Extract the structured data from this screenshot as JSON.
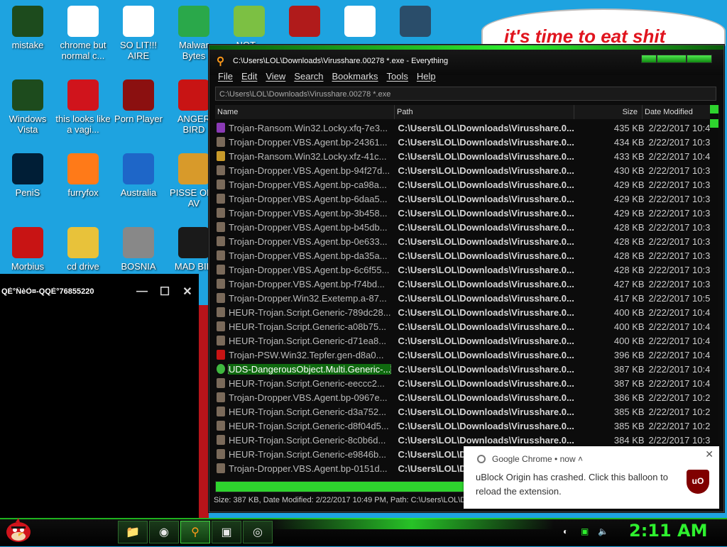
{
  "desktop_icons": [
    {
      "label": "mistake",
      "icon": "xbox-icon",
      "color": "#1d4b1d"
    },
    {
      "label": "chrome but normal c...",
      "icon": "chrome-icon",
      "color": "#ffffff"
    },
    {
      "label": "SO LIT!!! AIRE",
      "icon": "solitaire-icon",
      "color": "#ffffff"
    },
    {
      "label": "Malwar Bytes",
      "icon": "shield-icon",
      "color": "#2aa84a"
    },
    {
      "label": "NOT...",
      "icon": "bad-piggies-icon",
      "color": "#7cc043"
    },
    {
      "label": "",
      "icon": "exploit-icon",
      "color": "#b01b1b"
    },
    {
      "label": "",
      "icon": "media-player-classic-icon",
      "color": "#ffffff"
    },
    {
      "label": "",
      "icon": "grid-app-icon",
      "color": "#2a4d6a"
    },
    {
      "label": "Windows Vista",
      "icon": "recycle-icon",
      "color": "#1d4b1d"
    },
    {
      "label": "this looks like a vagi...",
      "icon": "opera-icon",
      "color": "#d0141c"
    },
    {
      "label": "Porn Player",
      "icon": "flash-icon",
      "color": "#8b1010"
    },
    {
      "label": "ANGER BIRD",
      "icon": "angry-birds-icon",
      "color": "#c81414"
    },
    {
      "label": "PeniS",
      "icon": "photoshop-icon",
      "color": "#001e36"
    },
    {
      "label": "furryfox",
      "icon": "firefox-icon",
      "color": "#ff7a18"
    },
    {
      "label": "Australia",
      "icon": "spider-solitaire-icon",
      "color": "#1e66c8"
    },
    {
      "label": "PISSE OFF AV",
      "icon": "angry-birds-seasons-icon",
      "color": "#d89a2a"
    },
    {
      "label": "Morbius",
      "icon": "acrobat-icon",
      "color": "#c81414"
    },
    {
      "label": "cd drive",
      "icon": "cd-icon",
      "color": "#e8c23a"
    },
    {
      "label": "BOSNIA",
      "icon": "minesweeper-icon",
      "color": "#888888"
    },
    {
      "label": "MAD BIR",
      "icon": "angry-birds-space-icon",
      "color": "#1a1a1a"
    }
  ],
  "bubble_text": "it's time to eat shit",
  "dark_window": {
    "title": "QÈ°ÑèÒ¤-QQÈ°76855220",
    "minimize": "—",
    "maximize": "☐",
    "close": "✕"
  },
  "everything": {
    "title": "C:\\Users\\LOL\\Downloads\\Virusshare.00278 *.exe - Everything",
    "menu": [
      "File",
      "Edit",
      "View",
      "Search",
      "Bookmarks",
      "Tools",
      "Help"
    ],
    "search_value": "C:\\Users\\LOL\\Downloads\\Virusshare.00278 *.exe",
    "columns": [
      "Name",
      "Path",
      "Size",
      "Date Modified"
    ],
    "rows": [
      {
        "name": "Trojan-Ransom.Win32.Locky.xfq-7e3...",
        "path": "C:\\Users\\LOL\\Downloads\\Virusshare.0...",
        "size": "435 KB",
        "date": "2/22/2017 10:4",
        "icon_color": "#8a3ab5"
      },
      {
        "name": "Trojan-Dropper.VBS.Agent.bp-24361...",
        "path": "C:\\Users\\LOL\\Downloads\\Virusshare.0...",
        "size": "434 KB",
        "date": "2/22/2017 10:3",
        "icon_color": "#7a6a5a"
      },
      {
        "name": "Trojan-Ransom.Win32.Locky.xfz-41c...",
        "path": "C:\\Users\\LOL\\Downloads\\Virusshare.0...",
        "size": "433 KB",
        "date": "2/22/2017 10:4",
        "icon_color": "#c89a2a"
      },
      {
        "name": "Trojan-Dropper.VBS.Agent.bp-94f27d...",
        "path": "C:\\Users\\LOL\\Downloads\\Virusshare.0...",
        "size": "430 KB",
        "date": "2/22/2017 10:3",
        "icon_color": "#7a6a5a"
      },
      {
        "name": "Trojan-Dropper.VBS.Agent.bp-ca98a...",
        "path": "C:\\Users\\LOL\\Downloads\\Virusshare.0...",
        "size": "429 KB",
        "date": "2/22/2017 10:3",
        "icon_color": "#7a6a5a"
      },
      {
        "name": "Trojan-Dropper.VBS.Agent.bp-6daa5...",
        "path": "C:\\Users\\LOL\\Downloads\\Virusshare.0...",
        "size": "429 KB",
        "date": "2/22/2017 10:3",
        "icon_color": "#7a6a5a"
      },
      {
        "name": "Trojan-Dropper.VBS.Agent.bp-3b458...",
        "path": "C:\\Users\\LOL\\Downloads\\Virusshare.0...",
        "size": "429 KB",
        "date": "2/22/2017 10:3",
        "icon_color": "#7a6a5a"
      },
      {
        "name": "Trojan-Dropper.VBS.Agent.bp-b45db...",
        "path": "C:\\Users\\LOL\\Downloads\\Virusshare.0...",
        "size": "428 KB",
        "date": "2/22/2017 10:3",
        "icon_color": "#7a6a5a"
      },
      {
        "name": "Trojan-Dropper.VBS.Agent.bp-0e633...",
        "path": "C:\\Users\\LOL\\Downloads\\Virusshare.0...",
        "size": "428 KB",
        "date": "2/22/2017 10:3",
        "icon_color": "#7a6a5a"
      },
      {
        "name": "Trojan-Dropper.VBS.Agent.bp-da35a...",
        "path": "C:\\Users\\LOL\\Downloads\\Virusshare.0...",
        "size": "428 KB",
        "date": "2/22/2017 10:3",
        "icon_color": "#7a6a5a"
      },
      {
        "name": "Trojan-Dropper.VBS.Agent.bp-6c6f55...",
        "path": "C:\\Users\\LOL\\Downloads\\Virusshare.0...",
        "size": "428 KB",
        "date": "2/22/2017 10:3",
        "icon_color": "#7a6a5a"
      },
      {
        "name": "Trojan-Dropper.VBS.Agent.bp-f74bd...",
        "path": "C:\\Users\\LOL\\Downloads\\Virusshare.0...",
        "size": "427 KB",
        "date": "2/22/2017 10:3",
        "icon_color": "#7a6a5a"
      },
      {
        "name": "Trojan-Dropper.Win32.Exetemp.a-87...",
        "path": "C:\\Users\\LOL\\Downloads\\Virusshare.0...",
        "size": "417 KB",
        "date": "2/22/2017 10:5",
        "icon_color": "#7a6a5a"
      },
      {
        "name": "HEUR-Trojan.Script.Generic-789dc28...",
        "path": "C:\\Users\\LOL\\Downloads\\Virusshare.0...",
        "size": "400 KB",
        "date": "2/22/2017 10:4",
        "icon_color": "#7a6a5a"
      },
      {
        "name": "HEUR-Trojan.Script.Generic-a08b75...",
        "path": "C:\\Users\\LOL\\Downloads\\Virusshare.0...",
        "size": "400 KB",
        "date": "2/22/2017 10:4",
        "icon_color": "#7a6a5a"
      },
      {
        "name": "HEUR-Trojan.Script.Generic-d71ea8...",
        "path": "C:\\Users\\LOL\\Downloads\\Virusshare.0...",
        "size": "400 KB",
        "date": "2/22/2017 10:4",
        "icon_color": "#7a6a5a"
      },
      {
        "name": "Trojan-PSW.Win32.Tepfer.gen-d8a0...",
        "path": "C:\\Users\\LOL\\Downloads\\Virusshare.0...",
        "size": "396 KB",
        "date": "2/22/2017 10:4",
        "icon_color": "#c81414"
      },
      {
        "name": "UDS-DangerousObject.Multi.Generic-...",
        "path": "C:\\Users\\LOL\\Downloads\\Virusshare.0...",
        "size": "387 KB",
        "date": "2/22/2017 10:4",
        "icon_color": "#3fb83f",
        "selected": true
      },
      {
        "name": "HEUR-Trojan.Script.Generic-eeccc2...",
        "path": "C:\\Users\\LOL\\Downloads\\Virusshare.0...",
        "size": "387 KB",
        "date": "2/22/2017 10:4",
        "icon_color": "#7a6a5a"
      },
      {
        "name": "Trojan-Dropper.VBS.Agent.bp-0967e...",
        "path": "C:\\Users\\LOL\\Downloads\\Virusshare.0...",
        "size": "386 KB",
        "date": "2/22/2017 10:2",
        "icon_color": "#7a6a5a"
      },
      {
        "name": "HEUR-Trojan.Script.Generic-d3a752...",
        "path": "C:\\Users\\LOL\\Downloads\\Virusshare.0...",
        "size": "385 KB",
        "date": "2/22/2017 10:2",
        "icon_color": "#7a6a5a"
      },
      {
        "name": "HEUR-Trojan.Script.Generic-d8f04d5...",
        "path": "C:\\Users\\LOL\\Downloads\\Virusshare.0...",
        "size": "385 KB",
        "date": "2/22/2017 10:2",
        "icon_color": "#7a6a5a"
      },
      {
        "name": "HEUR-Trojan.Script.Generic-8c0b6d...",
        "path": "C:\\Users\\LOL\\Downloads\\Virusshare.0...",
        "size": "384 KB",
        "date": "2/22/2017 10:3",
        "icon_color": "#7a6a5a"
      },
      {
        "name": "HEUR-Trojan.Script.Generic-e9846b...",
        "path": "C:\\Users\\LOL\\D",
        "size": "",
        "date": "",
        "icon_color": "#7a6a5a"
      },
      {
        "name": "Trojan-Dropper.VBS.Agent.bp-0151d...",
        "path": "C:\\Users\\LOL\\D",
        "size": "",
        "date": "",
        "icon_color": "#7a6a5a"
      }
    ],
    "status": "Size: 387 KB, Date Modified: 2/22/2017 10:49 PM, Path: C:\\Users\\LOL\\Do"
  },
  "notification": {
    "app": "Google Chrome",
    "time": "now",
    "message": "uBlock Origin has crashed. Click this balloon to reload the extension.",
    "badge": "uO",
    "close": "✕"
  },
  "taskbar": {
    "items": [
      {
        "name": "taskbar-file-explorer",
        "icon": "folder-icon",
        "glyph": "📁"
      },
      {
        "name": "taskbar-chrome",
        "icon": "chrome-icon",
        "glyph": "◉"
      },
      {
        "name": "taskbar-everything",
        "icon": "search-icon",
        "glyph": "⚲",
        "active": true
      },
      {
        "name": "taskbar-app4",
        "icon": "window-icon",
        "glyph": "▣"
      },
      {
        "name": "taskbar-app5",
        "icon": "purple-app-icon",
        "glyph": "◎"
      }
    ],
    "clock": "2:11 AM"
  },
  "colors": {
    "accent_green": "#2ef02e",
    "desktop_blue": "#1ea3e0",
    "selected_row": "#0f6a0f"
  }
}
